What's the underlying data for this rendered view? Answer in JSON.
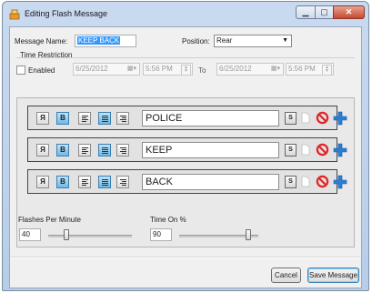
{
  "window": {
    "title": "Editing Flash Message",
    "min_glyph": "▁",
    "max_glyph": "▢",
    "close_glyph": "✕"
  },
  "form": {
    "message_name_label": "Message Name:",
    "message_name_value": "KEEP BACK",
    "position_label": "Position:",
    "position_value": "Rear"
  },
  "time_restriction": {
    "group_label": "Time Restriction",
    "enabled_label": "Enabled",
    "enabled_checked": false,
    "start_date": "6/25/2012",
    "start_time": "5:56 PM",
    "to_label": "To",
    "end_date": "6/25/2012",
    "end_time": "5:56 PM"
  },
  "messages": [
    {
      "reverse_label": "Я",
      "bold_label": "B",
      "text": "POLICE",
      "speed_label": "S"
    },
    {
      "reverse_label": "Я",
      "bold_label": "B",
      "text": "KEEP",
      "speed_label": "S"
    },
    {
      "reverse_label": "Я",
      "bold_label": "B",
      "text": "BACK",
      "speed_label": "S"
    }
  ],
  "flashes": {
    "label": "Flashes Per Minute",
    "value": "40",
    "level": 0.2
  },
  "time_on": {
    "label": "Time On %",
    "value": "90",
    "level": 0.9
  },
  "buttons": {
    "cancel": "Cancel",
    "save": "Save Message"
  },
  "colors": {
    "accent": "#3399ff",
    "ban": "#e0262a",
    "plus": "#2a7fd4",
    "bold_active": "#6fb9e6"
  },
  "icons": {
    "app": "app-flash-icon",
    "calendar": "calendar-icon",
    "doc": "document-icon",
    "ban": "prohibit-icon",
    "plus": "add-plus-icon"
  }
}
